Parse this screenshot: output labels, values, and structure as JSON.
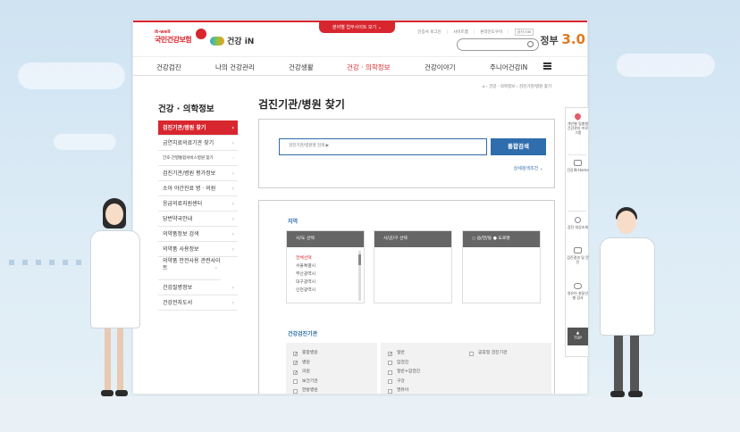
{
  "header": {
    "logo_top": "it-well",
    "logo_name": "국민건강보험",
    "logo2_text": "건강 iN",
    "pill_label": "분야별 업무사이트 보기",
    "util_links": [
      "인증서 로그인",
      "사이트맵",
      "온라인도우미",
      "글자"
    ],
    "gov_text": "정부",
    "gov_version": "3.0"
  },
  "gnb": {
    "items": [
      "건강검진",
      "나의 건강관리",
      "건강생활",
      "건강 · 의학정보",
      "건강이야기",
      "주니어건강iN"
    ]
  },
  "breadcrumb": "건강 · 의학정보 › 검진기관/병원 찾기",
  "lnb": {
    "title": "건강 · 의학정보",
    "items": [
      "검진기관/병원 찾기",
      "금연치료의료기관 찾기",
      "간호·간병통합서비스병원 찾기",
      "검진기관/병원 평가정보",
      "소아 야간진료 병 · 의원",
      "응급의료지원센터",
      "당번약국안내",
      "의약품정보 검색",
      "의약품 사용정보",
      "의약품 안전사용 관련사이트",
      "건강질병정보",
      "건강전자도서"
    ]
  },
  "main": {
    "title": "검진기관/병원 찾기",
    "search_placeholder": "검진기관/병원명 검색 ▶",
    "search_button": "통합검색",
    "advanced": "상세검색조건",
    "region_label": "지역",
    "col1_header": "시/도 선택",
    "col1_options": [
      "전체선택",
      "서울특별시",
      "부산광역시",
      "대구광역시",
      "인천광역시"
    ],
    "col2_header": "시/군/구 선택",
    "col3_header": "○ 읍/면/동 ● 도로명",
    "checkup_label": "건강검진기관",
    "group1": [
      {
        "label": "종합병원",
        "checked": true
      },
      {
        "label": "병원",
        "checked": true
      },
      {
        "label": "의원",
        "checked": true
      },
      {
        "label": "보건기관",
        "checked": false
      },
      {
        "label": "한방병원",
        "checked": false
      }
    ],
    "group2": [
      {
        "label": "일반",
        "checked": true
      },
      {
        "label": "암검진",
        "checked": false
      },
      {
        "label": "일반+암검진",
        "checked": false
      },
      {
        "label": "구강",
        "checked": false
      },
      {
        "label": "영유아",
        "checked": false
      }
    ],
    "group3": [
      {
        "label": "공휴일 검진기관",
        "checked": false
      }
    ]
  },
  "quick": {
    "item1": "개인별 맞춤형 건강관리 프로그램",
    "item2": "건강iN Home",
    "item3": "검진 대상조회",
    "item4": "검진결과 및 문진",
    "item5": "영유아 발달선별 검사",
    "top": "TOP"
  }
}
